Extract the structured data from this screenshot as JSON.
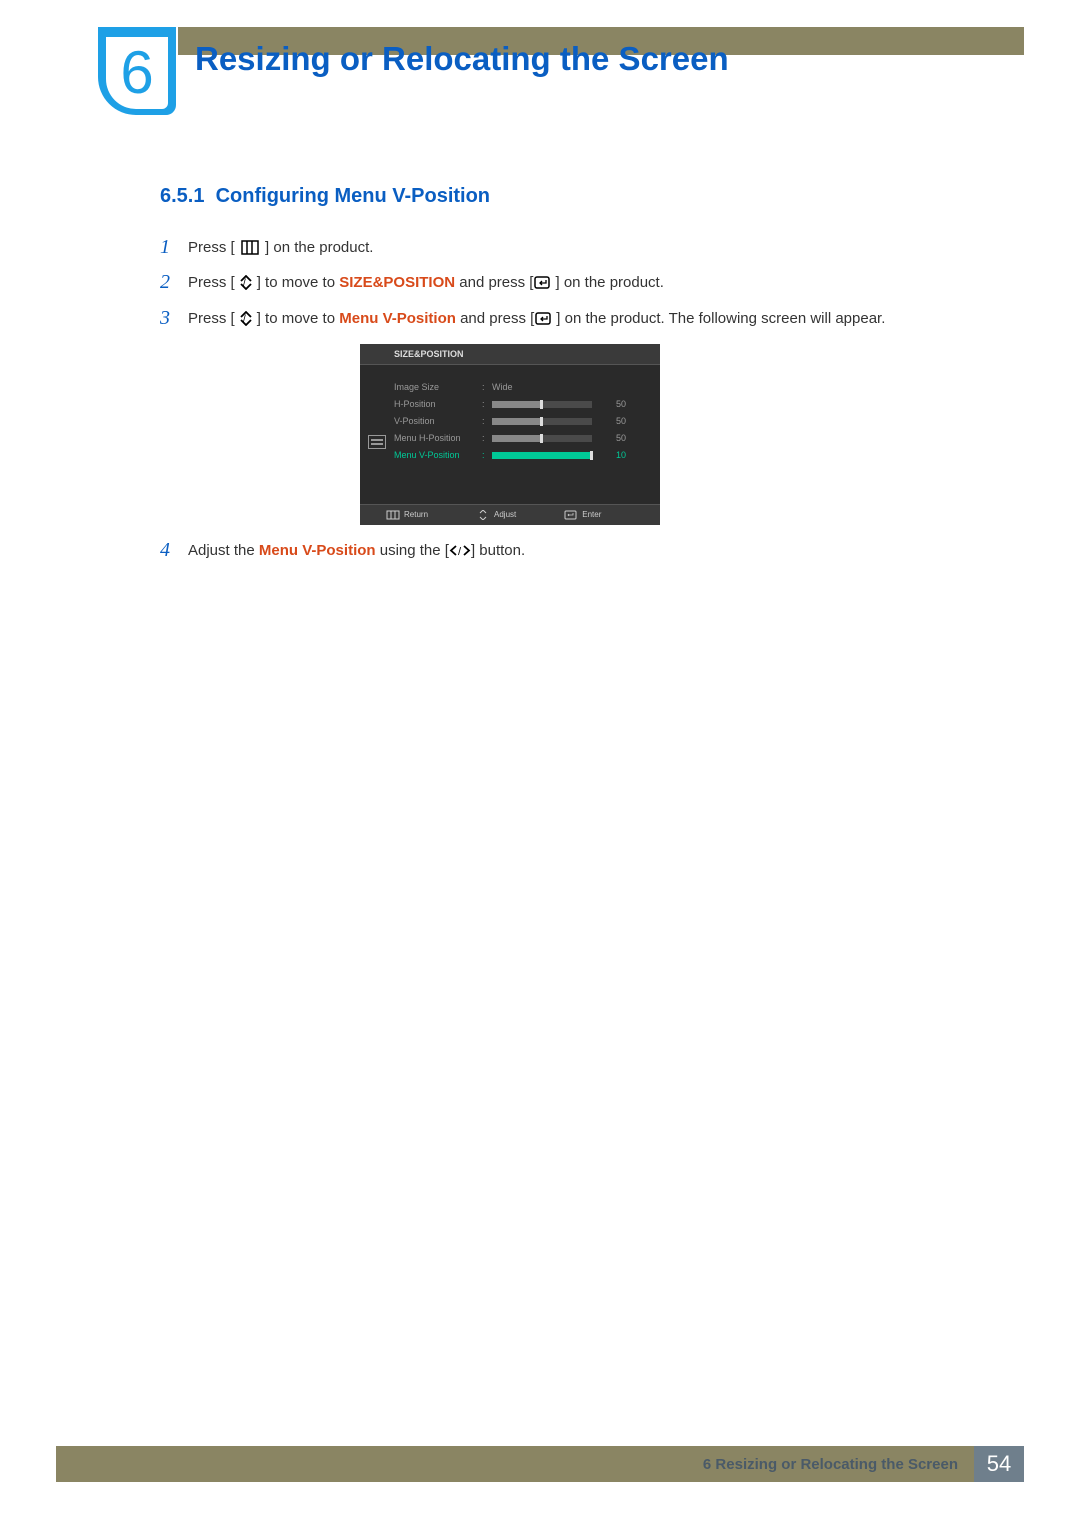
{
  "chapter": {
    "number": "6",
    "title": "Resizing or Relocating the Screen"
  },
  "section": {
    "number": "6.5.1",
    "title": "Configuring Menu V-Position"
  },
  "steps": {
    "s1": {
      "num": "1",
      "pre": "Press [ ",
      "post": " ] on the product."
    },
    "s2": {
      "num": "2",
      "pre": "Press [",
      "mid1": "] to move to ",
      "hl": "SIZE&POSITION",
      "mid2": " and press [",
      "post": "] on the product."
    },
    "s3": {
      "num": "3",
      "pre": "Press [",
      "mid1": "] to move to ",
      "hl": "Menu V-Position",
      "mid2": " and press [",
      "post": "] on the product. The following screen will appear."
    },
    "s4": {
      "num": "4",
      "pre": "Adjust the ",
      "hl": "Menu V-Position",
      "mid": " using the [",
      "post": "] button."
    }
  },
  "osd": {
    "title": "SIZE&POSITION",
    "rows": [
      {
        "label": "Image Size",
        "type": "text",
        "value": "Wide"
      },
      {
        "label": "H-Position",
        "type": "slider",
        "value": 50,
        "fill": 50
      },
      {
        "label": "V-Position",
        "type": "slider",
        "value": 50,
        "fill": 50
      },
      {
        "label": "Menu H-Position",
        "type": "slider",
        "value": 50,
        "fill": 50
      },
      {
        "label": "Menu V-Position",
        "type": "slider",
        "value": 10,
        "fill": 100,
        "active": true
      }
    ],
    "footer": {
      "return": "Return",
      "adjust": "Adjust",
      "enter": "Enter"
    }
  },
  "footer": {
    "text": "6 Resizing or Relocating the Screen",
    "page": "54"
  }
}
